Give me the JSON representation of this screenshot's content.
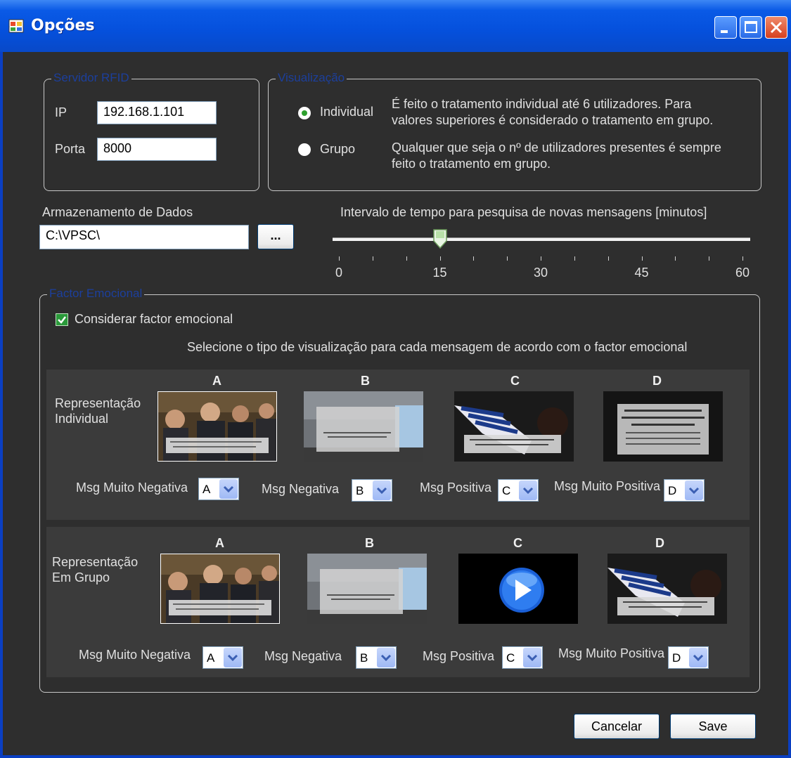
{
  "window": {
    "title": "Opções"
  },
  "servidor": {
    "legend": "Servidor RFID",
    "ip_label": "IP",
    "ip_value": "192.168.1.101",
    "porta_label": "Porta",
    "porta_value": "8000"
  },
  "visualizacao": {
    "legend": "Visualização",
    "options": [
      {
        "label": "Individual",
        "selected": true,
        "desc1": "É feito o tratamento individual até 6 utilizadores. Para",
        "desc2": "valores superiores é considerado o tratamento em grupo."
      },
      {
        "label": "Grupo",
        "selected": false,
        "desc1": "Qualquer que seja o nº de utilizadores presentes é sempre",
        "desc2": "feito o tratamento em grupo."
      }
    ]
  },
  "armazenamento": {
    "label": "Armazenamento de Dados",
    "path": "C:\\VPSC\\",
    "browse_label": "..."
  },
  "intervalo": {
    "label": "Intervalo de tempo para pesquisa de novas mensagens  [minutos]",
    "min": 0,
    "max": 60,
    "value": 15,
    "tick_labels": [
      "0",
      "15",
      "30",
      "45",
      "60"
    ]
  },
  "factor": {
    "legend": "Factor Emocional",
    "checkbox_label": "Considerar factor emocional",
    "checked": true,
    "instruction": "Selecione o tipo de visualização para cada mensagem de acordo com o factor emocional",
    "individual": {
      "label_line1": "Representação",
      "label_line2": "Individual",
      "letters": [
        "A",
        "B",
        "C",
        "D"
      ],
      "selectors": [
        {
          "label": "Msg Muito Negativa",
          "value": "A"
        },
        {
          "label": "Msg Negativa",
          "value": "B"
        },
        {
          "label": "Msg Positiva",
          "value": "C"
        },
        {
          "label": "Msg Muito Positiva",
          "value": "D"
        }
      ]
    },
    "grupo": {
      "label_line1": "Representação",
      "label_line2": "Em Grupo",
      "letters": [
        "A",
        "B",
        "C",
        "D"
      ],
      "selectors": [
        {
          "label": "Msg Muito Negativa",
          "value": "A"
        },
        {
          "label": "Msg Negativa",
          "value": "B"
        },
        {
          "label": "Msg Positiva",
          "value": "C"
        },
        {
          "label": "Msg Muito Positiva",
          "value": "D"
        }
      ]
    }
  },
  "actions": {
    "cancel": "Cancelar",
    "save": "Save"
  },
  "colors": {
    "titlebar": "#0550dc",
    "dialog_bg": "#2e2e2e",
    "legend_text": "#1c3f9c",
    "radio_dot": "#2ea02e"
  }
}
